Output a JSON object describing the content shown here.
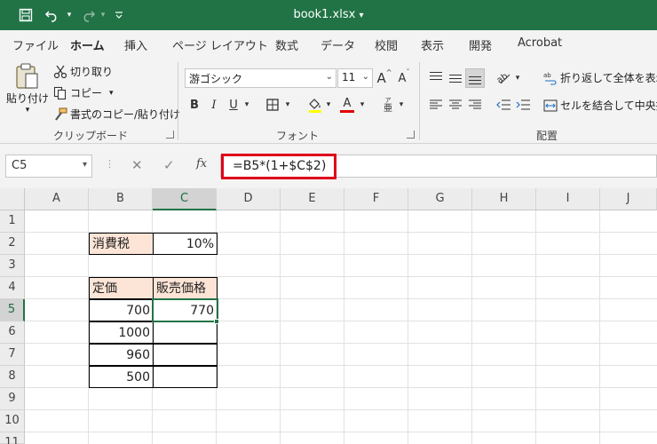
{
  "window": {
    "title": "book1.xlsx",
    "title_arrow": "▾"
  },
  "quick_access": {
    "save_icon": "save-icon",
    "undo_icon": "undo-icon",
    "redo_icon": "redo-icon",
    "customize_icon": "customize-qat-icon"
  },
  "tabs": [
    "ファイル",
    "ホーム",
    "挿入",
    "ページ レイアウト",
    "数式",
    "データ",
    "校閲",
    "表示",
    "開発",
    "Acrobat"
  ],
  "active_tab": "ホーム",
  "ribbon": {
    "clipboard": {
      "paste": "貼り付け",
      "cut": "切り取り",
      "copy": "コピー",
      "format_painter": "書式のコピー/貼り付け",
      "label": "クリップボード"
    },
    "font": {
      "name": "游ゴシック",
      "size": "11",
      "grow": "A",
      "shrink": "A",
      "bold": "B",
      "italic": "I",
      "underline": "U",
      "font_color_letter": "A",
      "phonetic": "亜",
      "label": "フォント",
      "font_color": "#e00000"
    },
    "alignment": {
      "wrap_text": "折り返して全体を表示する",
      "merge_center": "セルを結合して中央揃え",
      "label": "配置"
    }
  },
  "formula_bar": {
    "name_box": "C5",
    "cancel": "✕",
    "enter": "✓",
    "fx": "fx",
    "formula": "=B5*(1+$C$2)"
  },
  "sheet": {
    "columns": [
      "A",
      "B",
      "C",
      "D",
      "E",
      "F",
      "G",
      "H",
      "I",
      "J"
    ],
    "rows": [
      "1",
      "2",
      "3",
      "4",
      "5",
      "6",
      "7",
      "8",
      "9",
      "10",
      "11"
    ],
    "selected_column": "C",
    "selected_row": "5",
    "cells": {
      "B2": "消費税",
      "C2": "10%",
      "B4": "定価",
      "C4": "販売価格",
      "B5": "700",
      "C5": "770",
      "B6": "1000",
      "C6": "",
      "B7": "960",
      "C7": "",
      "B8": "500",
      "C8": ""
    }
  },
  "colors": {
    "accent": "#217346",
    "header_fill": "#fce4d6",
    "highlight": "#e0001b"
  }
}
